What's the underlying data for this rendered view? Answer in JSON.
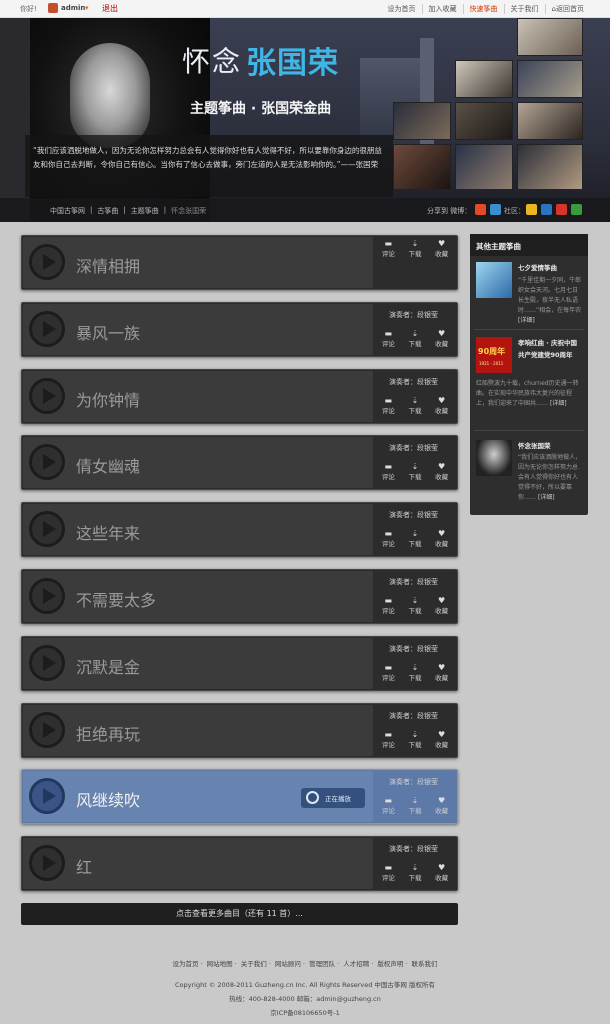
{
  "topbar": {
    "hello": "你好!",
    "username": "admin",
    "logout": "退出",
    "links": [
      "设为首页",
      "加入收藏",
      "快速筝曲",
      "关于我们",
      "返回首页"
    ],
    "highlight_index": 2
  },
  "banner": {
    "title_left": "怀念",
    "title_right": "张国荣",
    "subtitle": "主题筝曲 · 张国荣金曲",
    "quote": "“我们应该洒脱地做人，因为无论你怎样努力总会有人觉得你好也有人觉得不好，所以要靠你身边的很朋益友和你自己去判断，令你自己有信心。当你有了信心去做事，旁门左道的人是无法影响你的。”——张国荣"
  },
  "breadcrumb": {
    "items": [
      "中国古筝网",
      "古筝曲",
      "主题筝曲",
      "怀念张国荣"
    ],
    "share_label": "分享到",
    "weibo_label": "微博：",
    "community_label": "社区："
  },
  "songs": [
    {
      "name": "深情相拥",
      "performer": "",
      "active": false
    },
    {
      "name": "暴风一族",
      "performer": "演奏者：段银莹",
      "active": false
    },
    {
      "name": "为你钟情",
      "performer": "演奏者：段银莹",
      "active": false
    },
    {
      "name": "倩女幽魂",
      "performer": "演奏者：段银莹",
      "active": false
    },
    {
      "name": "这些年来",
      "performer": "演奏者：段银莹",
      "active": false
    },
    {
      "name": "不需要太多",
      "performer": "演奏者：段银莹",
      "active": false
    },
    {
      "name": "沉默是金",
      "performer": "演奏者：段银莹",
      "active": false
    },
    {
      "name": "拒绝再玩",
      "performer": "演奏者：段银莹",
      "active": false
    },
    {
      "name": "风继续吹",
      "performer": "演奏者：段银莹",
      "active": true
    },
    {
      "name": "红",
      "performer": "演奏者：段银莹",
      "active": false
    }
  ],
  "song_actions": {
    "comment": "评论",
    "download": "下载",
    "favorite": "收藏"
  },
  "now_playing_label": "正在播放",
  "more_button": "点击查看更多曲目（还有  11  首）...",
  "sidebar": {
    "title": "其他主题筝曲",
    "items": [
      {
        "title": "七夕爱情筝曲",
        "desc": "“千里佳期一夕同，牛郎织女会天河。七月七日长生殿，夜半无人私语时……”相会，在每年农",
        "more": "[详细]"
      },
      {
        "title": "孝响红曲 · 庆祝中国共产党建党90周年",
        "badge_top": "90周年",
        "badge_bottom": "1921 - 2011",
        "desc": "红船劈波九十载，churned历史通一转曲。在实现中华民族伟大复兴的征程上，我们迎来了中国共……",
        "more": "[详细]"
      },
      {
        "title": "怀念张国荣",
        "desc": "“我们应该洒脱地做人，因为无论你怎样努力总会有人觉得你好也有人觉得不好，所以要靠你……",
        "more": "[详细]"
      }
    ]
  },
  "footer": {
    "nav": [
      "设为首页",
      "网站地图",
      "关于我们",
      "网站顾问",
      "管理团队",
      "人才招聘",
      "版权声明",
      "联系我们"
    ],
    "copyright": "Copyright © 2008-2011 Guzheng.cn Inc. All Rights Reserved    中国古筝网 版权所有",
    "contact": "热线：400-828-4000    邮箱：admin@guzheng.cn",
    "icp": "京ICP备08106650号-1"
  },
  "colors": {
    "accent_blue": "#3fb6e8",
    "active_row": "#5c79a8",
    "logout_red": "#c00000",
    "highlight_link": "#d23a00"
  }
}
